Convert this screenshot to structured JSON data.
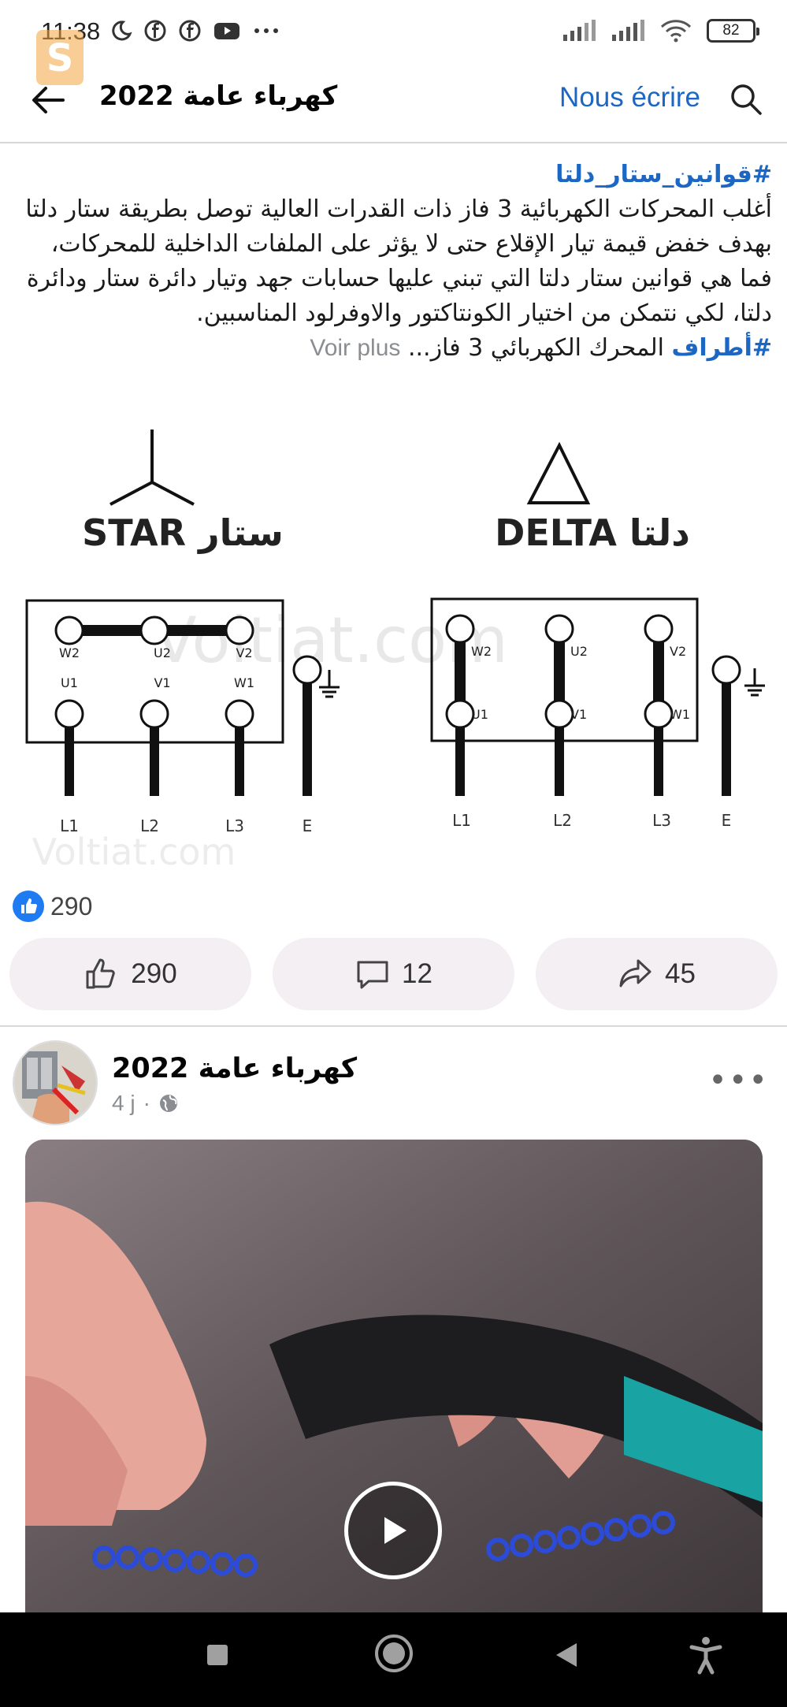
{
  "status_bar": {
    "time": "11:38",
    "battery": "82"
  },
  "header": {
    "title": "كهرباء عامة 2022",
    "message_link": "Nous écrire"
  },
  "post1": {
    "hashtag_title": "#قوانين_ستار_دلتا",
    "body": "أغلب المحركات الكهربائية 3 فاز ذات القدرات العالية توصل بطريقة ستار دلتا بهدف خفض قيمة تيار الإقلاع حتى لا يؤثر على الملفات الداخلية للمحركات، فما هي قوانين ستار دلتا التي تبني عليها حسابات جهد وتيار دائرة ستار ودائرة دلتا، لكي نتمكن من اختيار الكونتاكتور والاوفرلود المناسبين.",
    "hashtag_line": "#أطراف",
    "line_rest": " المحرك الكهربائي 3 فاز... ",
    "see_more": "Voir plus",
    "diagram": {
      "star_label": "STAR ستار",
      "delta_label": "DELTA دلتا",
      "watermark": "Voltiat.com",
      "star_top_terminals": [
        "W2",
        "U2",
        "V2"
      ],
      "star_bottom_terminals": [
        "U1",
        "V1",
        "W1"
      ],
      "delta_top_terminals": [
        "W2",
        "U2",
        "V2"
      ],
      "delta_bottom_terminals": [
        "U1",
        "V1",
        "W1"
      ],
      "lines": [
        "L1",
        "L2",
        "L3",
        "E"
      ]
    },
    "reaction_count": "290",
    "actions": {
      "like_count": "290",
      "comment_count": "12",
      "share_count": "45"
    }
  },
  "post2": {
    "page_name": "كهرباء عامة 2022",
    "time": "4 j",
    "separator": "·"
  },
  "colors": {
    "link_blue": "#1c67c4",
    "like_blue": "#1f7bf2",
    "action_bg": "#f3eff2"
  }
}
